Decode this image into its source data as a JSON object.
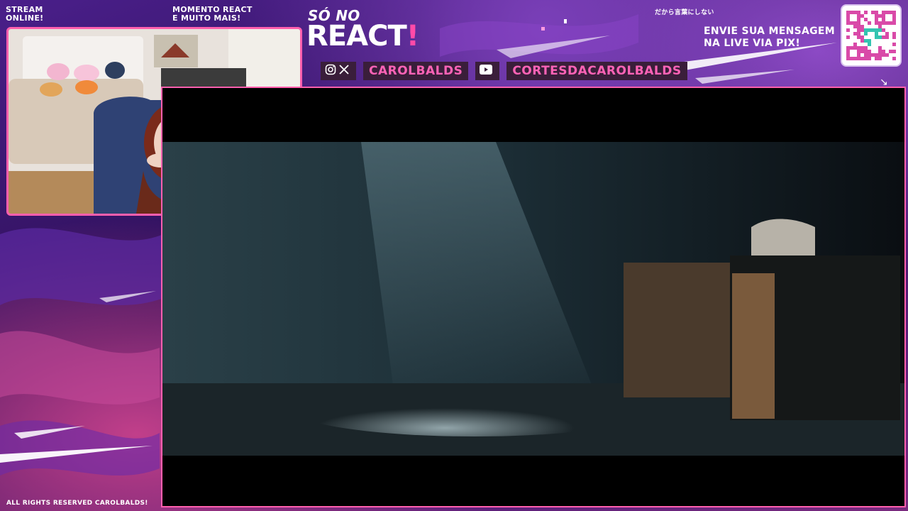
{
  "header": {
    "stream_status": "STREAM\nONLINE!",
    "stream_line1": "STREAM",
    "stream_line2": "ONLINE!",
    "momento_line1": "MOMENTO REACT",
    "momento_line2": "E MUITO MAIS!",
    "show_title_small": "SÓ NO",
    "show_title_big": "REACT",
    "show_title_bang": "!",
    "jp_text": "だから言葉にしない",
    "pix_line1": "ENVIE SUA MENSAGEM",
    "pix_line2": "NA LIVE VIA PIX!"
  },
  "socials": {
    "instagram_icon": "instagram-icon",
    "x_icon": "x-icon",
    "instagram_x_handle": "CAROLBALDS",
    "youtube_icon": "youtube-icon",
    "youtube_handle": "CORTESDACAROLBALDS"
  },
  "footer": {
    "rights": "ALL RIGHTS RESERVED CAROLBALDS!"
  },
  "colors": {
    "accent_pink": "#ff5fae",
    "handle_pink": "#ff63b6",
    "bg_purple": "#3a1766"
  }
}
